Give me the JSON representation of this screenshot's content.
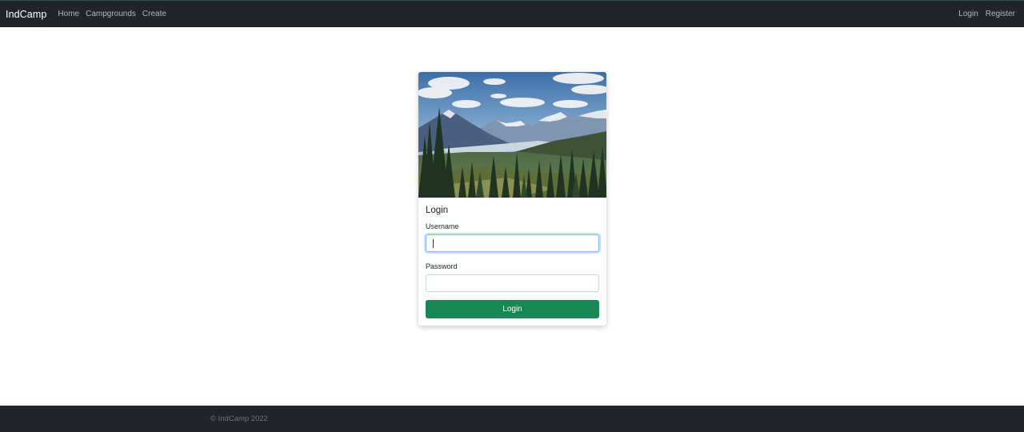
{
  "navbar": {
    "brand": "IndCamp",
    "links": [
      "Home",
      "Campgrounds",
      "Create"
    ],
    "right_links": [
      "Login",
      "Register"
    ]
  },
  "card": {
    "image_alt": "Mountain landscape with evergreen forest and lake",
    "title": "Login",
    "username_label": "Username",
    "username_value": "",
    "password_label": "Password",
    "password_value": "",
    "submit_label": "Login"
  },
  "footer": {
    "text": "© IndCamp 2022"
  },
  "colors": {
    "navbar_bg": "#212529",
    "button_bg": "#198754",
    "focus_border": "#86b7fe"
  }
}
